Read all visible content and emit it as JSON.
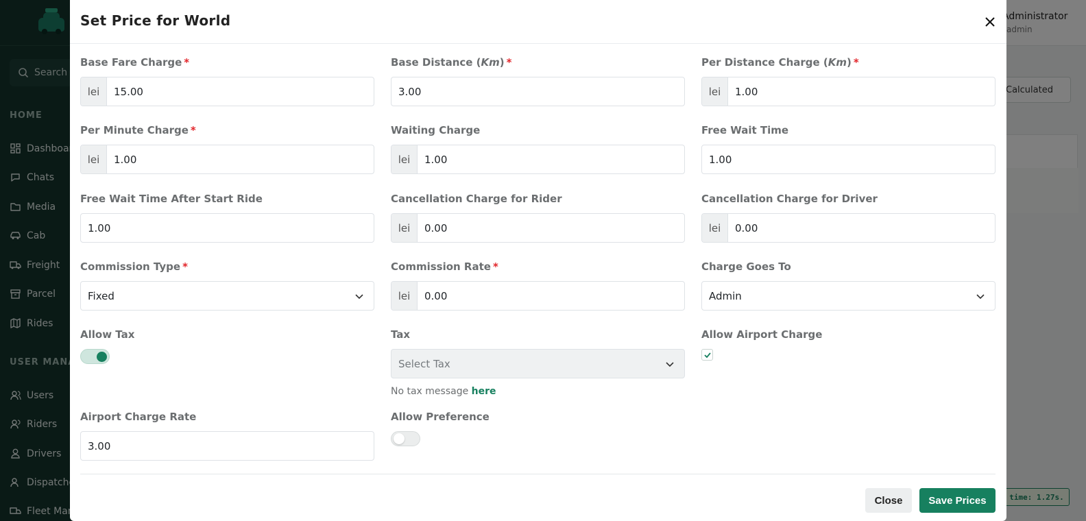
{
  "background": {
    "search_placeholder": "Search",
    "sections": [
      {
        "label": "HOME"
      },
      {
        "label": "USER MANAG"
      }
    ],
    "nav_items": [
      {
        "label": "Dashboard",
        "icon": "dashboard-icon"
      },
      {
        "label": "Chats",
        "icon": "chat-icon"
      },
      {
        "label": "Media",
        "icon": "folder-icon"
      },
      {
        "label": "Cab",
        "icon": "car-icon"
      },
      {
        "label": "Freight",
        "icon": "truck-icon"
      },
      {
        "label": "Parcel",
        "icon": "parcel-icon"
      },
      {
        "label": "Rides",
        "icon": "map-icon"
      },
      {
        "label": "Users",
        "icon": "users-icon"
      },
      {
        "label": "Riders",
        "icon": "riders-icon"
      },
      {
        "label": "Drivers",
        "icon": "driver-icon"
      },
      {
        "label": "Dispatcher",
        "icon": "dispatcher-icon"
      },
      {
        "label": "Fleet Man",
        "icon": "fleet-icon"
      }
    ],
    "admin_name": "Administrator",
    "admin_role": "admin",
    "calculated_button": "Calculated",
    "timer": "time: 1.27s."
  },
  "modal": {
    "title": "Set Price for World",
    "currency_symbol": "lei",
    "fields": {
      "base_fare": {
        "label": "Base Fare Charge",
        "value": "15.00"
      },
      "base_distance": {
        "label": "Base Distance (",
        "unit": "Km",
        "label_end": ")",
        "value": "3.00"
      },
      "per_distance": {
        "label": "Per Distance Charge (",
        "unit": "Km",
        "label_end": ")",
        "value": "1.00"
      },
      "per_minute": {
        "label": "Per Minute Charge",
        "value": "1.00"
      },
      "waiting_charge": {
        "label": "Waiting Charge",
        "value": "1.00"
      },
      "free_wait": {
        "label": "Free Wait Time",
        "value": "1.00"
      },
      "free_wait_after_start": {
        "label": "Free Wait Time After Start Ride",
        "value": "1.00"
      },
      "cancel_rider": {
        "label": "Cancellation Charge for Rider",
        "value": "0.00"
      },
      "cancel_driver": {
        "label": "Cancellation Charge for Driver",
        "value": "0.00"
      },
      "commission_type": {
        "label": "Commission Type",
        "value": "Fixed"
      },
      "commission_rate": {
        "label": "Commission Rate",
        "value": "0.00"
      },
      "charge_goes_to": {
        "label": "Charge Goes To",
        "value": "Admin"
      },
      "allow_tax": {
        "label": "Allow Tax",
        "checked": true
      },
      "tax": {
        "label": "Tax",
        "placeholder": "Select Tax",
        "help": "No tax message",
        "help_link": "here"
      },
      "allow_airport": {
        "label": "Allow Airport Charge",
        "checked": true
      },
      "airport_rate": {
        "label": "Airport Charge Rate",
        "value": "3.00"
      },
      "allow_preference": {
        "label": "Allow Preference",
        "checked": false
      }
    },
    "buttons": {
      "close": "Close",
      "save": "Save Prices"
    }
  },
  "colors": {
    "accent": "#17805f",
    "required": "#e2262b",
    "sidebar": "#14342c"
  }
}
